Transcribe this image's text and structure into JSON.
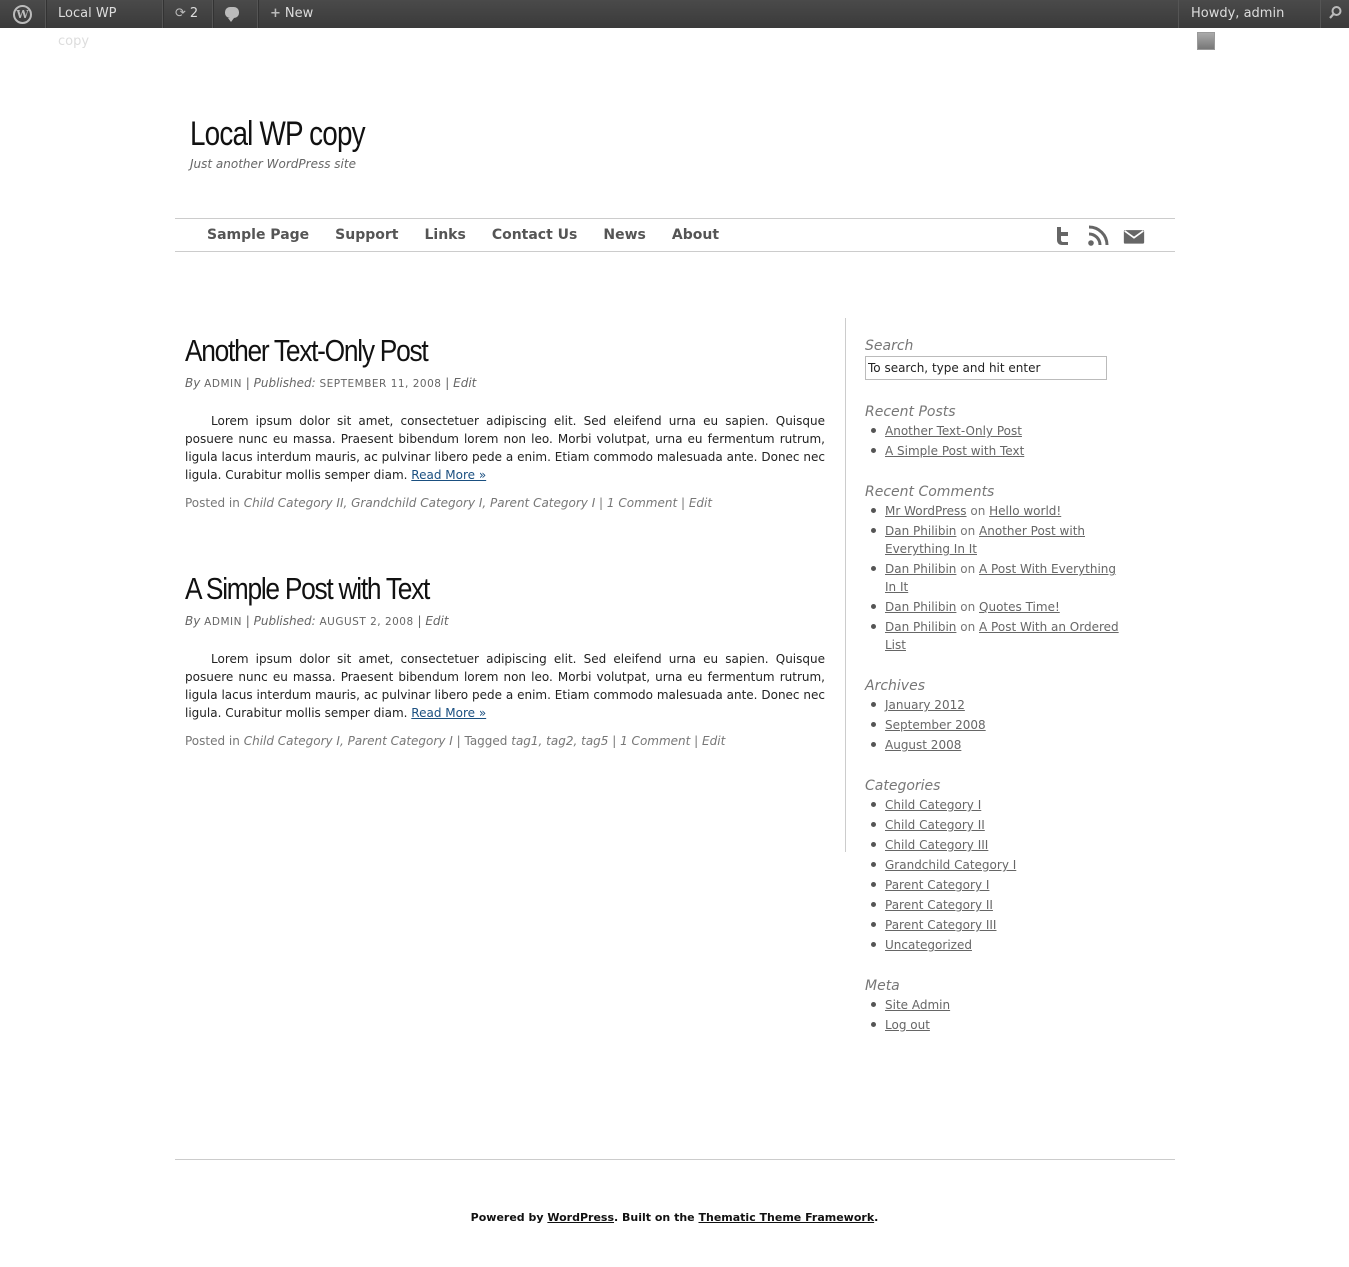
{
  "adminbar": {
    "site_name": "Local WP copy",
    "updates_count": "2",
    "new_label": "New",
    "howdy": "Howdy, admin"
  },
  "header": {
    "title": "Local WP copy",
    "description": "Just another WordPress site"
  },
  "nav": {
    "items": [
      "Sample Page",
      "Support",
      "Links",
      "Contact Us",
      "News",
      "About"
    ]
  },
  "posts": [
    {
      "title": "Another Text-Only Post",
      "by": "By",
      "author": "ADMIN",
      "published_label": "Published:",
      "date": "SEPTEMBER 11, 2008",
      "edit": "Edit",
      "body": "Lorem ipsum dolor sit amet, consectetuer adipiscing elit. Sed eleifend urna eu sapien. Quisque posuere nunc eu massa. Praesent bibendum lorem non leo. Morbi volutpat, urna eu fermentum rutrum, ligula lacus interdum mauris, ac pulvinar libero pede a enim. Etiam commodo malesuada ante. Donec nec ligula. Curabitur mollis semper diam.",
      "read_more": "Read More »",
      "posted_in": "Posted in",
      "categories": "Child Category II, Grandchild Category I, Parent Category I",
      "tagged_label": "",
      "tags": "",
      "comments": "1 Comment",
      "foot_edit": "Edit"
    },
    {
      "title": "A Simple Post with Text",
      "by": "By",
      "author": "ADMIN",
      "published_label": "Published:",
      "date": "AUGUST 2, 2008",
      "edit": "Edit",
      "body": "Lorem ipsum dolor sit amet, consectetuer adipiscing elit. Sed eleifend urna eu sapien. Quisque posuere nunc eu massa. Praesent bibendum lorem non leo. Morbi volutpat, urna eu fermentum rutrum, ligula lacus interdum mauris, ac pulvinar libero pede a enim. Etiam commodo malesuada ante. Donec nec ligula. Curabitur mollis semper diam.",
      "read_more": "Read More »",
      "posted_in": "Posted in",
      "categories": "Child Category I, Parent Category I",
      "tagged_label": "Tagged",
      "tags": "tag1, tag2, tag5",
      "comments": "1 Comment",
      "foot_edit": "Edit"
    }
  ],
  "sidebar": {
    "search": {
      "title": "Search",
      "placeholder": "To search, type and hit enter"
    },
    "recent_posts": {
      "title": "Recent Posts",
      "items": [
        "Another Text-Only Post",
        "A Simple Post with Text"
      ]
    },
    "recent_comments": {
      "title": "Recent Comments",
      "on": "on",
      "items": [
        {
          "author": "Mr WordPress",
          "post": "Hello world!"
        },
        {
          "author": "Dan Philibin",
          "post": "Another Post with Everything In It"
        },
        {
          "author": "Dan Philibin",
          "post": "A Post With Everything In It"
        },
        {
          "author": "Dan Philibin",
          "post": "Quotes Time!"
        },
        {
          "author": "Dan Philibin",
          "post": "A Post With an Ordered List"
        }
      ]
    },
    "archives": {
      "title": "Archives",
      "items": [
        "January 2012",
        "September 2008",
        "August 2008"
      ]
    },
    "categories": {
      "title": "Categories",
      "items": [
        "Child Category I",
        "Child Category II",
        "Child Category III",
        "Grandchild Category I",
        "Parent Category I",
        "Parent Category II",
        "Parent Category III",
        "Uncategorized"
      ]
    },
    "meta": {
      "title": "Meta",
      "items": [
        "Site Admin",
        "Log out"
      ]
    }
  },
  "footer": {
    "powered_by": "Powered by",
    "wordpress": "WordPress",
    "built_on": ". Built on the",
    "thematic": "Thematic Theme Framework",
    "end": "."
  },
  "icons": {
    "wp_logo": "wordpress-logo-icon",
    "updates": "refresh-icon",
    "comments": "comment-icon",
    "new": "plus-icon",
    "search": "search-icon",
    "twitter": "twitter-icon",
    "rss": "rss-icon",
    "email": "email-icon"
  }
}
